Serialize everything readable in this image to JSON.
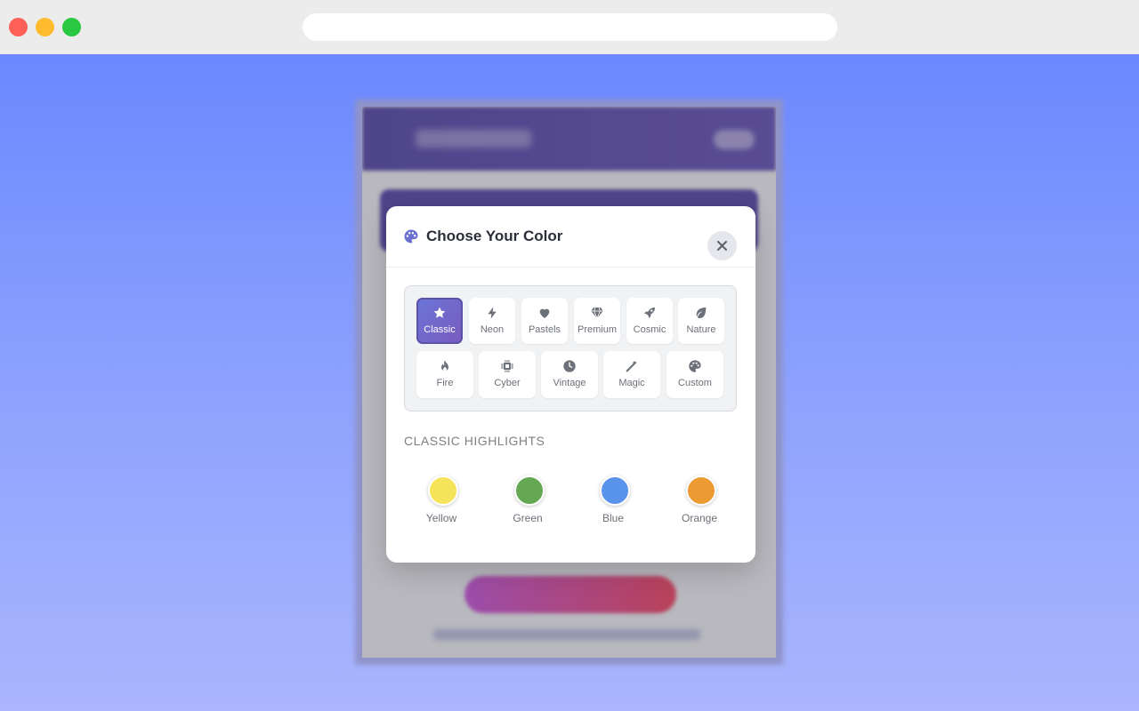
{
  "modal": {
    "title": "Choose Your Color",
    "close_label": "close",
    "categories": [
      {
        "label": "Classic",
        "icon": "star-icon",
        "active": true
      },
      {
        "label": "Neon",
        "icon": "bolt-icon"
      },
      {
        "label": "Pastels",
        "icon": "heart-icon"
      },
      {
        "label": "Premium",
        "icon": "gem-icon"
      },
      {
        "label": "Cosmic",
        "icon": "rocket-icon"
      },
      {
        "label": "Nature",
        "icon": "leaf-icon"
      },
      {
        "label": "Fire",
        "icon": "fire-icon"
      },
      {
        "label": "Cyber",
        "icon": "microchip-icon"
      },
      {
        "label": "Vintage",
        "icon": "clock-icon"
      },
      {
        "label": "Magic",
        "icon": "wand-icon"
      },
      {
        "label": "Custom",
        "icon": "palette-icon"
      }
    ],
    "section_title": "CLASSIC HIGHLIGHTS",
    "colors": [
      {
        "name": "Yellow",
        "hex": "#f5e45a"
      },
      {
        "name": "Green",
        "hex": "#64a853"
      },
      {
        "name": "Blue",
        "hex": "#5a93ec"
      },
      {
        "name": "Orange",
        "hex": "#ec9a33"
      }
    ]
  },
  "theme": {
    "accent": "#6a6fd0",
    "page_gradient": [
      "#6584ff",
      "#aab5fd"
    ]
  }
}
